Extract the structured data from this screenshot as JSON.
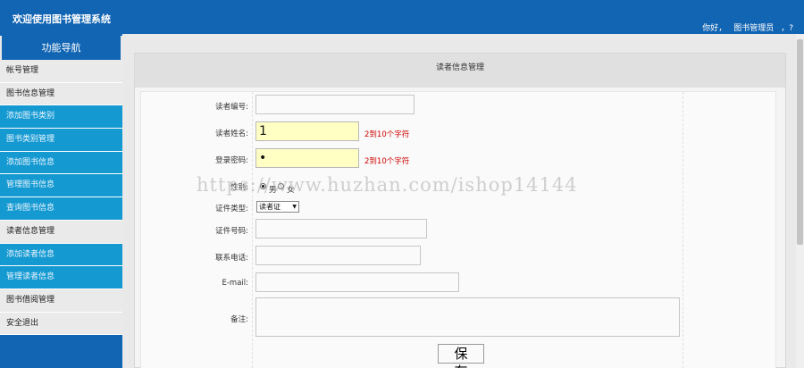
{
  "header": {
    "app_title": "欢迎使用图书管理系统",
    "greeting": "你好，",
    "user_role": "图书管理员",
    "user_suffix": "，?"
  },
  "sidebar": {
    "title": "功能导航",
    "items": [
      {
        "label": "帐号管理",
        "kind": "group"
      },
      {
        "label": "图书信息管理",
        "kind": "group"
      },
      {
        "label": "添加图书类别",
        "kind": "sub"
      },
      {
        "label": "图书类别管理",
        "kind": "sub"
      },
      {
        "label": "添加图书信息",
        "kind": "sub"
      },
      {
        "label": "管理图书信息",
        "kind": "sub"
      },
      {
        "label": "查询图书信息",
        "kind": "sub"
      },
      {
        "label": "读者信息管理",
        "kind": "group"
      },
      {
        "label": "添加读者信息",
        "kind": "sub"
      },
      {
        "label": "管理读者信息",
        "kind": "sub"
      },
      {
        "label": "图书借阅管理",
        "kind": "group"
      },
      {
        "label": "安全退出",
        "kind": "group"
      }
    ]
  },
  "main": {
    "panel_title": "读者信息管理",
    "form": {
      "reader_id": {
        "label": "读者编号:",
        "value": ""
      },
      "reader_name": {
        "label": "读者姓名:",
        "value": "1",
        "hint": "2到10个字符"
      },
      "password": {
        "label": "登录密码:",
        "value": "•",
        "hint": "2到10个字符"
      },
      "gender": {
        "label": "性别:",
        "options": [
          "男",
          "女"
        ],
        "selected": "男"
      },
      "id_type": {
        "label": "证件类型:",
        "value": "读者证"
      },
      "id_number": {
        "label": "证件号码:",
        "value": ""
      },
      "phone": {
        "label": "联系电话:",
        "value": ""
      },
      "email": {
        "label": "E-mail:",
        "value": ""
      },
      "remark": {
        "label": "备注:",
        "value": ""
      },
      "save_label": "保存"
    }
  },
  "watermark": "https://www.huzhan.com/ishop14144",
  "colors": {
    "header_blue": "#1265b3",
    "submenu_blue": "#1599d1",
    "hint_red": "#d00000",
    "input_yellow": "#ffffc3"
  }
}
